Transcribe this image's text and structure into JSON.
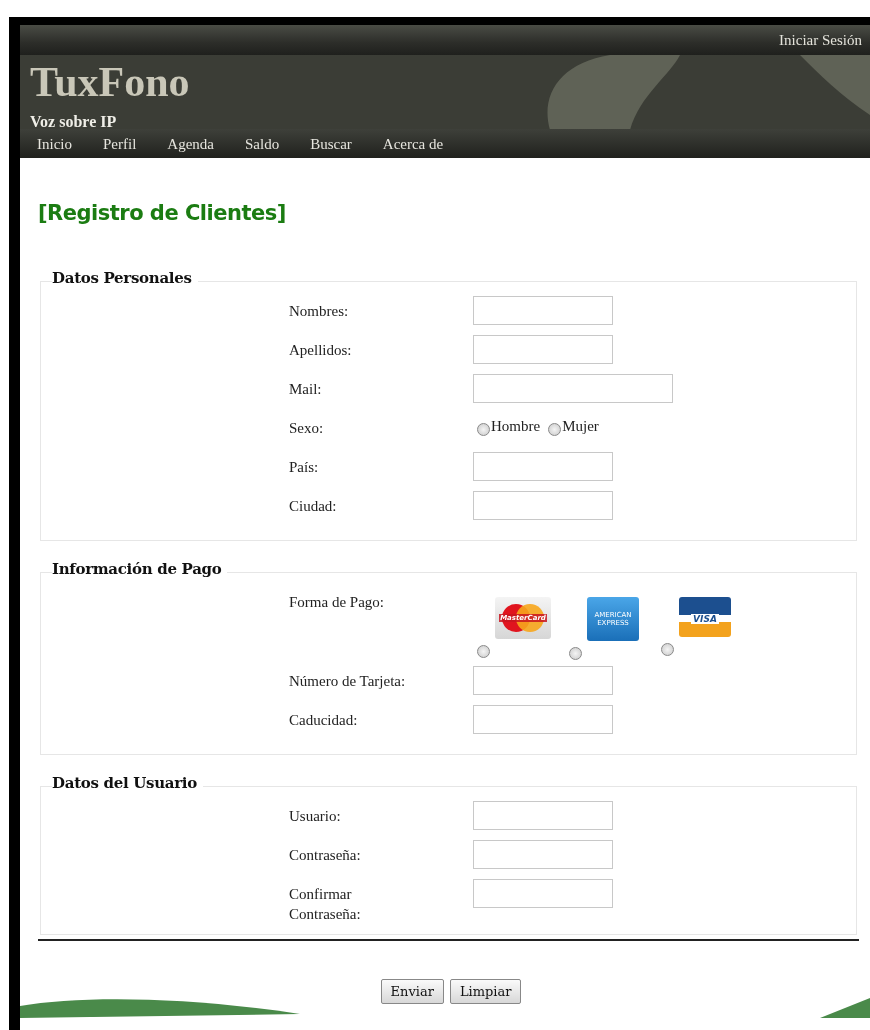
{
  "header": {
    "login_link": "Iniciar Sesión",
    "site_title": "TuxFono",
    "tagline": "Voz sobre IP",
    "nav": [
      {
        "label": "Inicio"
      },
      {
        "label": "Perfil"
      },
      {
        "label": "Agenda"
      },
      {
        "label": "Saldo"
      },
      {
        "label": "Buscar"
      },
      {
        "label": "Acerca de"
      }
    ]
  },
  "page_title": "[Registro de Clientes]",
  "sections": [
    {
      "legend": "Datos Personales",
      "rows": [
        {
          "kind": "text",
          "label": "Nombres:",
          "wide": false
        },
        {
          "kind": "text",
          "label": "Apellidos:",
          "wide": false
        },
        {
          "kind": "text",
          "label": "Mail:",
          "wide": true
        },
        {
          "kind": "radio",
          "label": "Sexo:",
          "options": [
            {
              "label": "Hombre",
              "selected": false
            },
            {
              "label": "Mujer",
              "selected": false
            }
          ]
        },
        {
          "kind": "text",
          "label": "País:",
          "wide": false
        },
        {
          "kind": "text",
          "label": "Ciudad:",
          "wide": false
        }
      ]
    },
    {
      "legend": "Información de Pago",
      "rows": [
        {
          "kind": "cards",
          "label": "Forma de Pago:",
          "options": [
            {
              "kind": "mastercard",
              "text": "MasterCard",
              "selected": false
            },
            {
              "kind": "amex",
              "text": "AMERICAN EXPRESS",
              "selected": false
            },
            {
              "kind": "visa",
              "text": "VISA",
              "selected": false
            }
          ]
        },
        {
          "kind": "text",
          "label": "Número de Tarjeta:",
          "wide": false
        },
        {
          "kind": "text",
          "label": "Caducidad:",
          "wide": false
        }
      ]
    },
    {
      "legend": "Datos del Usuario",
      "rows": [
        {
          "kind": "text",
          "label": "Usuario:",
          "wide": false
        },
        {
          "kind": "password",
          "label": "Contraseña:",
          "wide": false
        },
        {
          "kind": "password",
          "label": "Confirmar\nContraseña:",
          "wide": false
        }
      ]
    }
  ],
  "buttons": [
    {
      "label": "Enviar"
    },
    {
      "label": "Limpiar"
    }
  ]
}
